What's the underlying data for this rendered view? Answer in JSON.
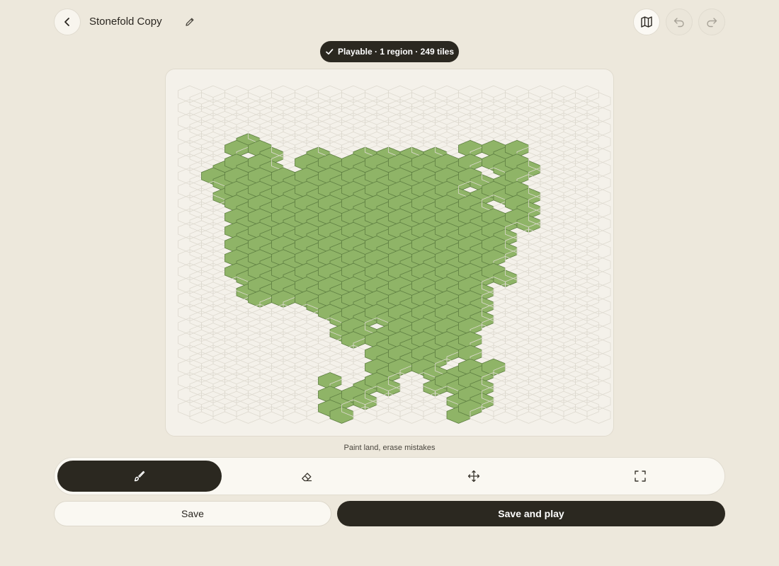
{
  "header": {
    "title": "Stonefold Copy",
    "icons": [
      "back-icon",
      "pencil-icon",
      "map-icon",
      "undo-icon",
      "redo-icon"
    ]
  },
  "status": {
    "text": "Playable · 1 region · 249 tiles",
    "icon": "check-icon"
  },
  "board": {
    "land_color": "#8fb467",
    "land_stroke": "#5e7f42",
    "empty_stroke": "#dedad0"
  },
  "hint": "Paint land, erase mistakes",
  "tools": [
    {
      "name": "paint",
      "icon": "brush-icon",
      "active": true
    },
    {
      "name": "erase",
      "icon": "eraser-icon",
      "active": false
    },
    {
      "name": "move",
      "icon": "move-icon",
      "active": false
    },
    {
      "name": "fit",
      "icon": "fullscreen-icon",
      "active": false
    }
  ],
  "actions": {
    "save_label": "Save",
    "save_play_label": "Save and play"
  }
}
